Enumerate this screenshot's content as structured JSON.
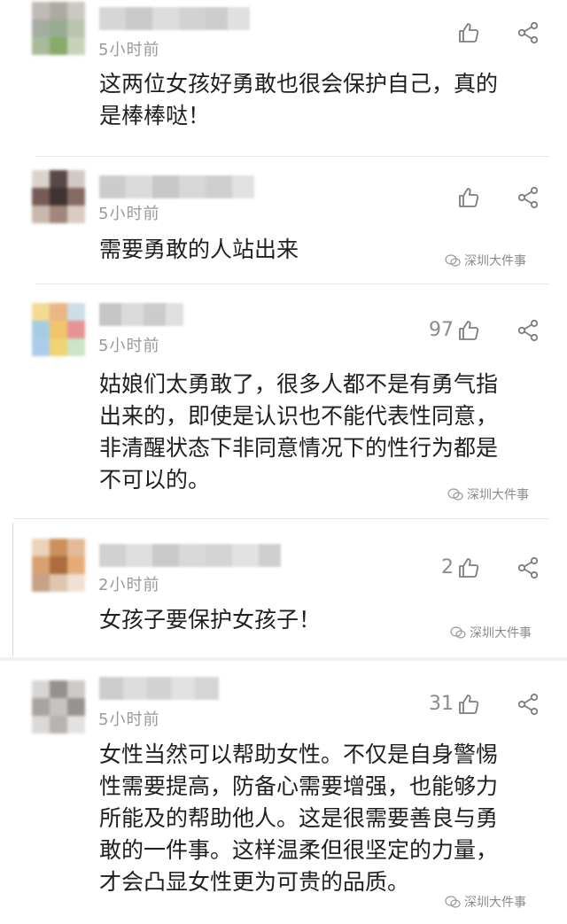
{
  "watermark_text": "深圳大件事",
  "comments": [
    {
      "time": "5小时前",
      "like_count": "",
      "text_lines": [
        "这两位女孩好勇敢也很会保护自己，真的",
        "是棒棒哒！"
      ]
    },
    {
      "time": "5小时前",
      "like_count": "",
      "text_lines": [
        "需要勇敢的人站出来"
      ]
    },
    {
      "time": "5小时前",
      "like_count": "97",
      "text_lines": [
        "姑娘们太勇敢了，很多人都不是有勇气指",
        "出来的，即使是认识也不能代表性同意，",
        "非清醒状态下非同意情况下的性行为都是",
        "不可以的。"
      ]
    },
    {
      "time": "2小时前",
      "like_count": "2",
      "text_lines": [
        "女孩子要保护女孩子！"
      ]
    },
    {
      "time": "5小时前",
      "like_count": "31",
      "text_lines": [
        "女性当然可以帮助女性。不仅是自身警惕",
        "性需要提高，防备心需要增强，也能够力",
        "所能及的帮助他人。这是很需要善良与勇",
        "敢的一件事。这样温柔但很坚定的力量，",
        "才会凸显女性更为可贵的品质。"
      ]
    }
  ]
}
